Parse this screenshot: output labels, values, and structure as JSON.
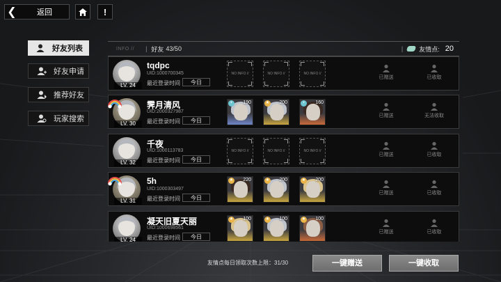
{
  "topbar": {
    "back_label": "返回",
    "home_icon": "home-icon",
    "alert_label": "!"
  },
  "sidebar": {
    "items": [
      {
        "label": "好友列表",
        "icon": "friend-list-icon",
        "active": true
      },
      {
        "label": "好友申请",
        "icon": "friend-request-icon",
        "active": false
      },
      {
        "label": "推荐好友",
        "icon": "recommend-friend-icon",
        "active": false
      },
      {
        "label": "玩家搜索",
        "icon": "player-search-icon",
        "active": false
      }
    ]
  },
  "header": {
    "info_tag": "INFO //",
    "friends_label": "好友",
    "friends_count": "43/50",
    "friendship_label": "友情点:",
    "friendship_value": "20",
    "friendship_color": "#9fd6c4"
  },
  "friends": [
    {
      "name": "tqdpc",
      "uid": "UID:1000700345",
      "level": "LV. 24",
      "login_label": "最近登录时间",
      "login_value": "今日",
      "cards": [
        {
          "empty": true,
          "text": "NO INFO //"
        },
        {
          "empty": true,
          "text": "NO INFO //"
        },
        {
          "empty": true,
          "text": "NO INFO //"
        }
      ],
      "send_status": "已赠送",
      "receive_status": "已收取"
    },
    {
      "name": "霁月清风",
      "uid": "UID:2000327987",
      "level": "LV. 30",
      "login_label": "最近登录时间",
      "login_value": "今日",
      "cards": [
        {
          "empty": false,
          "level": "190",
          "frame": "blue",
          "badge": "cross"
        },
        {
          "empty": false,
          "level": "200",
          "frame": "gold",
          "badge": "star"
        },
        {
          "empty": false,
          "level": "160",
          "frame": "orange",
          "badge": "cross"
        }
      ],
      "send_status": "已赠送",
      "receive_status": "无法收取"
    },
    {
      "name": "千夜",
      "uid": "UID:1000113783",
      "level": "LV. 32",
      "login_label": "最近登录时间",
      "login_value": "今日",
      "cards": [
        {
          "empty": true,
          "text": "NO INFO //"
        },
        {
          "empty": true,
          "text": "NO INFO //"
        },
        {
          "empty": true,
          "text": "NO INFO //"
        }
      ],
      "send_status": "已赠送",
      "receive_status": "已收取"
    },
    {
      "name": "5h",
      "uid": "UID:1000303497",
      "level": "LV. 31",
      "login_label": "最近登录时间",
      "login_value": "今日",
      "cards": [
        {
          "empty": false,
          "level": "220",
          "frame": "gold",
          "badge": "star"
        },
        {
          "empty": false,
          "level": "200",
          "frame": "gold",
          "badge": "star"
        },
        {
          "empty": false,
          "level": "200",
          "frame": "gold",
          "badge": "star"
        }
      ],
      "send_status": "已赠送",
      "receive_status": "已收取"
    },
    {
      "name": "凝天旧夏天丽",
      "uid": "UID:1000698561",
      "level": "LV. 24",
      "login_label": "最近登录时间",
      "login_value": "今日",
      "cards": [
        {
          "empty": false,
          "level": "100",
          "frame": "gold",
          "badge": "star"
        },
        {
          "empty": false,
          "level": "100",
          "frame": "gold",
          "badge": "star"
        },
        {
          "empty": false,
          "level": "100",
          "frame": "orange",
          "badge": "star"
        }
      ],
      "send_status": "已赠送",
      "receive_status": "已收取"
    }
  ],
  "footer": {
    "limit_text": "友情点每日领取次数上限：31/30",
    "send_all": "一键赠送",
    "receive_all": "一键收取"
  }
}
